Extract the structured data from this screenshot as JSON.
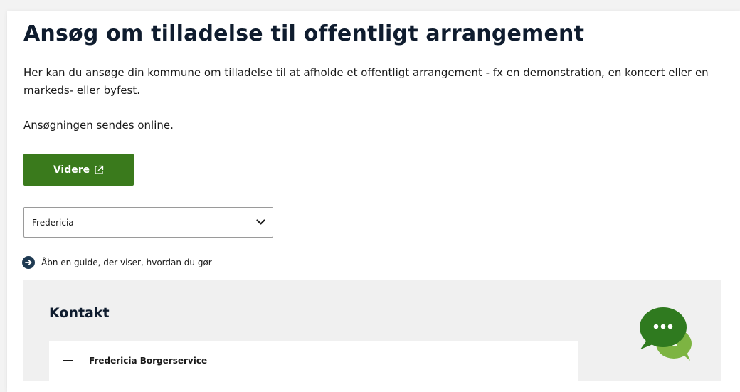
{
  "page": {
    "title": "Ansøg om tilladelse til offentligt arrangement",
    "intro": "Her kan du ansøge din kommune om tilladelse til at afholde et offentligt arrangement - fx en demonstration, en koncert eller en markeds- eller byfest.",
    "online_note": "Ansøgningen sendes online."
  },
  "actions": {
    "videre_label": "Videre",
    "videre_icon": "external-link-icon"
  },
  "municipality_select": {
    "selected": "Fredericia",
    "icon": "chevron-down-icon"
  },
  "guide": {
    "label": "Åbn en guide, der viser, hvordan du gør",
    "icon": "arrow-right-circle-icon"
  },
  "contact": {
    "heading": "Kontakt",
    "items": [
      {
        "label": "Fredericia Borgerservice",
        "expanded": true
      }
    ]
  },
  "chat": {
    "icon": "chat-bubble-icon"
  },
  "colors": {
    "accent_green": "#3a7a1c",
    "chat_green": "#2f7a1f",
    "chat_light_green": "#7db442",
    "heading": "#0f1c2e",
    "guide_icon_bg": "#1f3a52",
    "contact_bg": "#f0f0f0"
  }
}
